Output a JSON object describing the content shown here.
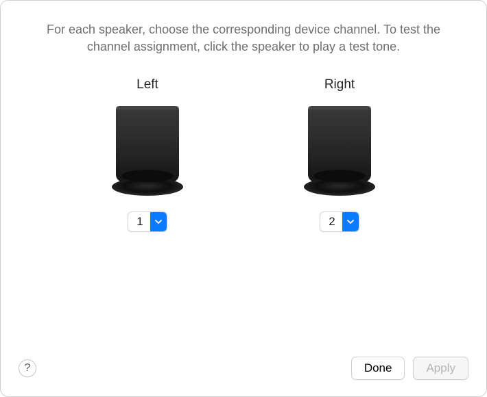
{
  "instruction": "For each speaker, choose the corresponding device channel. To test the channel assignment, click the speaker to play a test tone.",
  "speakers": {
    "left": {
      "label": "Left",
      "channel": "1"
    },
    "right": {
      "label": "Right",
      "channel": "2"
    }
  },
  "buttons": {
    "help": "?",
    "done": "Done",
    "apply": "Apply"
  }
}
